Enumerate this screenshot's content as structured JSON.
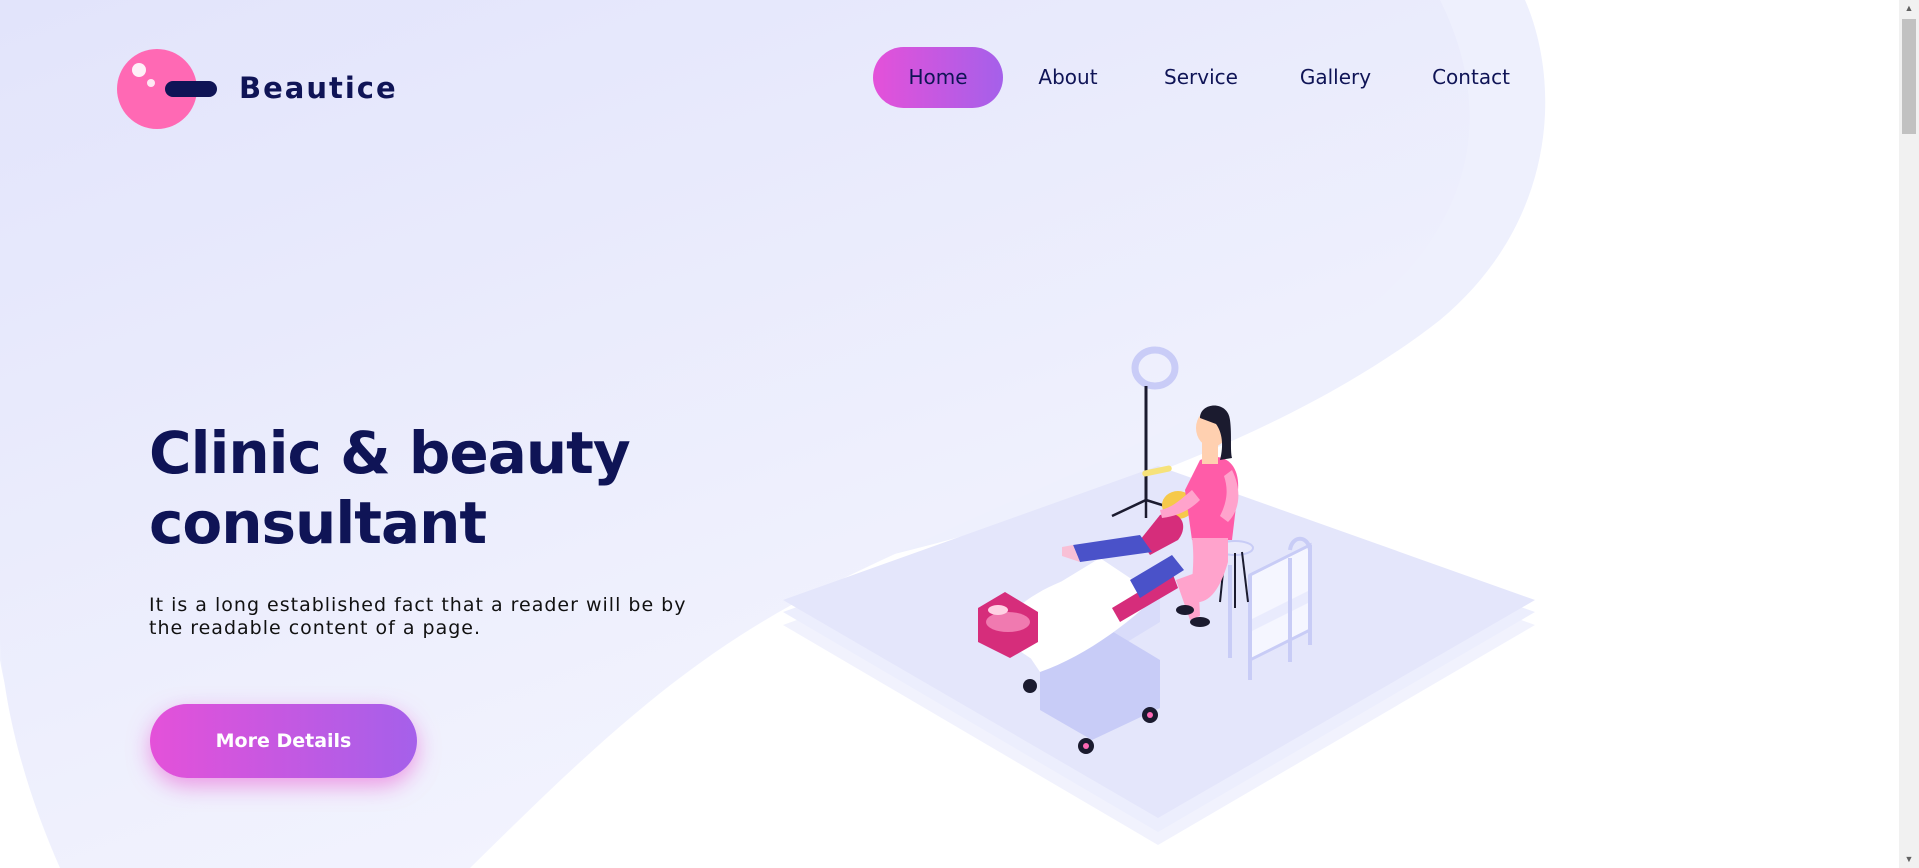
{
  "brand": {
    "name": "Beautice",
    "logo_color": "#ff69b4",
    "text_color": "#0f1456"
  },
  "nav": {
    "items": [
      {
        "label": "Home",
        "active": true
      },
      {
        "label": "About",
        "active": false
      },
      {
        "label": "Service",
        "active": false
      },
      {
        "label": "Gallery",
        "active": false
      },
      {
        "label": "Contact",
        "active": false
      }
    ]
  },
  "hero": {
    "title_line1": "Clinic & beauty",
    "title_line2": "consultant",
    "description": "It is a long established fact that a reader will be by the readable content of a page.",
    "cta_label": "More Details"
  },
  "colors": {
    "accent_start": "#e451d9",
    "accent_end": "#a560ea",
    "background": "#e6e8fc"
  },
  "icons": {
    "scroll_up": "arrow-up-icon",
    "scroll_down": "arrow-down-icon"
  }
}
